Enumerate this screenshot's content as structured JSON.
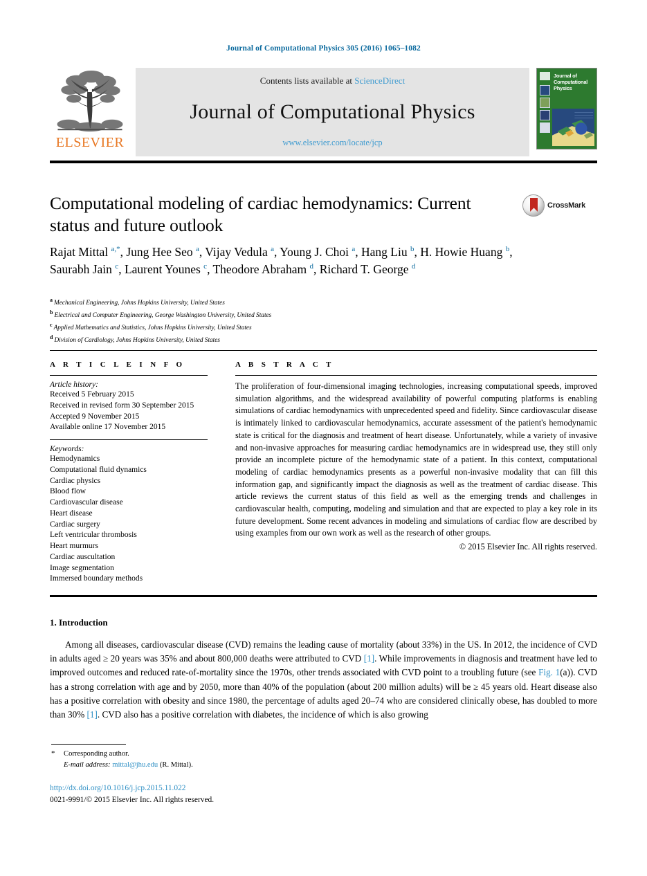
{
  "running_head": "Journal of Computational Physics 305 (2016) 1065–1082",
  "masthead": {
    "publisher": "ELSEVIER",
    "contents_prefix": "Contents lists available at ",
    "contents_link": "ScienceDirect",
    "journal_name": "Journal of Computational Physics",
    "journal_url": "www.elsevier.com/locate/jcp",
    "cover_title": "Journal of Computational Physics"
  },
  "article": {
    "title": "Computational modeling of cardiac hemodynamics: Current status and future outlook",
    "crossmark_label": "CrossMark",
    "authors_html": "Rajat Mittal <sup>a,*</sup>, Jung Hee Seo <sup>a</sup>, Vijay Vedula <sup>a</sup>, Young J. Choi <sup>a</sup>, Hang Liu <sup>b</sup>, H. Howie Huang <sup>b</sup>, Saurabh Jain <sup>c</sup>, Laurent Younes <sup>c</sup>, Theodore Abraham <sup>d</sup>, Richard T. George <sup>d</sup>",
    "affiliations": [
      {
        "mark": "a",
        "text": "Mechanical Engineering, Johns Hopkins University, United States"
      },
      {
        "mark": "b",
        "text": "Electrical and Computer Engineering, George Washington University, United States"
      },
      {
        "mark": "c",
        "text": "Applied Mathematics and Statistics, Johns Hopkins University, United States"
      },
      {
        "mark": "d",
        "text": "Division of Cardiology, Johns Hopkins University, United States"
      }
    ]
  },
  "article_info": {
    "heading": "A R T I C L E    I N F O",
    "history_label": "Article history:",
    "history": [
      "Received 5 February 2015",
      "Received in revised form 30 September 2015",
      "Accepted 9 November 2015",
      "Available online 17 November 2015"
    ],
    "keywords_label": "Keywords:",
    "keywords": [
      "Hemodynamics",
      "Computational fluid dynamics",
      "Cardiac physics",
      "Blood flow",
      "Cardiovascular disease",
      "Heart disease",
      "Cardiac surgery",
      "Left ventricular thrombosis",
      "Heart murmurs",
      "Cardiac auscultation",
      "Image segmentation",
      "Immersed boundary methods"
    ]
  },
  "abstract": {
    "heading": "A B S T R A C T",
    "text": "The proliferation of four-dimensional imaging technologies, increasing computational speeds, improved simulation algorithms, and the widespread availability of powerful computing platforms is enabling simulations of cardiac hemodynamics with unprecedented speed and fidelity. Since cardiovascular disease is intimately linked to cardiovascular hemodynamics, accurate assessment of the patient's hemodynamic state is critical for the diagnosis and treatment of heart disease. Unfortunately, while a variety of invasive and non-invasive approaches for measuring cardiac hemodynamics are in widespread use, they still only provide an incomplete picture of the hemodynamic state of a patient. In this context, computational modeling of cardiac hemodynamics presents as a powerful non-invasive modality that can fill this information gap, and significantly impact the diagnosis as well as the treatment of cardiac disease. This article reviews the current status of this field as well as the emerging trends and challenges in cardiovascular health, computing, modeling and simulation and that are expected to play a key role in its future development. Some recent advances in modeling and simulations of cardiac flow are described by using examples from our own work as well as the research of other groups.",
    "copyright": "© 2015 Elsevier Inc. All rights reserved."
  },
  "introduction": {
    "heading": "1. Introduction",
    "paragraph_parts": [
      "Among all diseases, cardiovascular disease (CVD) remains the leading cause of mortality (about 33%) in the US. In 2012, the incidence of CVD in adults aged ≥ 20 years was 35% and about 800,000 deaths were attributed to CVD ",
      "[1]",
      ". While improvements in diagnosis and treatment have led to improved outcomes and reduced rate-of-mortality since the 1970s, other trends associated with CVD point to a troubling future (see ",
      "Fig. 1",
      "(a)). CVD has a strong correlation with age and by 2050, more than 40% of the population (about 200 million adults) will be ≥ 45 years old. Heart disease also has a positive correlation with obesity and since 1980, the percentage of adults aged 20–74 who are considered clinically obese, has doubled to more than 30% ",
      "[1]",
      ". CVD also has a positive correlation with diabetes, the incidence of which is also growing"
    ]
  },
  "footnote": {
    "corresponding_author": "Corresponding author.",
    "email_label": "E-mail address:",
    "email": "mittal@jhu.edu",
    "email_suffix": "(R. Mittal)."
  },
  "footer": {
    "doi": "http://dx.doi.org/10.1016/j.jcp.2015.11.022",
    "issn_line": "0021-9991/© 2015 Elsevier Inc. All rights reserved."
  },
  "colors": {
    "link_blue": "#2e8fc4",
    "header_blue": "#0b6a9e",
    "elsevier_orange": "#e87722",
    "cover_green": "#2d7a2f",
    "panel_gray": "#e4e4e4"
  }
}
